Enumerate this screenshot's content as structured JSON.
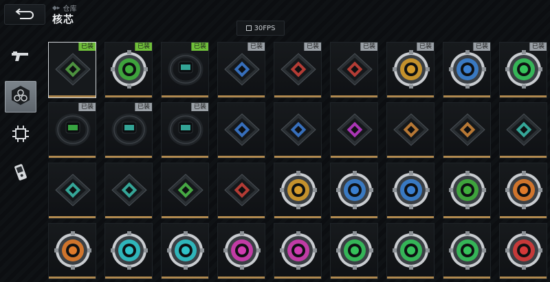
{
  "header": {
    "breadcrumb": "仓库",
    "title": "核芯",
    "fps_label": "30FPS"
  },
  "sidebar": {
    "items": [
      {
        "icon": "gun-icon",
        "active": false
      },
      {
        "icon": "core-hex-icon",
        "active": true
      },
      {
        "icon": "chip-icon",
        "active": false
      },
      {
        "icon": "device-icon",
        "active": false
      }
    ]
  },
  "colors": {
    "equipped_green": "#6fbf3a",
    "equipped_gray": "#9aa0a6",
    "rarity_bar": "#b0894f"
  },
  "grid": {
    "rows": [
      [
        {
          "kind": "chip",
          "color": "#57a845",
          "tag": "已装",
          "tag_style": "green",
          "selected": true
        },
        {
          "kind": "disc",
          "color": "#3fae3c",
          "tag": "已装",
          "tag_style": "green"
        },
        {
          "kind": "band",
          "color": "#3bbfae",
          "tag": "已装",
          "tag_style": "green"
        },
        {
          "kind": "chip",
          "color": "#3d7fd8",
          "tag": "已装",
          "tag_style": "gray"
        },
        {
          "kind": "chip",
          "color": "#d0433a",
          "tag": "已装",
          "tag_style": "gray"
        },
        {
          "kind": "chip",
          "color": "#d0433a",
          "tag": "已装",
          "tag_style": "gray"
        },
        {
          "kind": "disc",
          "color": "#d49a2a",
          "tag": "已装",
          "tag_style": "gray"
        },
        {
          "kind": "disc",
          "color": "#3a7fd0",
          "tag": "已装",
          "tag_style": "gray"
        },
        {
          "kind": "disc",
          "color": "#35c25a",
          "tag": "已装",
          "tag_style": "gray"
        }
      ],
      [
        {
          "kind": "band",
          "color": "#3fbf4a",
          "tag": "已装",
          "tag_style": "gray"
        },
        {
          "kind": "band",
          "color": "#3bbfae",
          "tag": "已装",
          "tag_style": "gray"
        },
        {
          "kind": "band",
          "color": "#3bbfae",
          "tag": "已装",
          "tag_style": "gray"
        },
        {
          "kind": "chip",
          "color": "#3d7fd8"
        },
        {
          "kind": "chip",
          "color": "#3d7fd8"
        },
        {
          "kind": "chip",
          "color": "#c43bd0"
        },
        {
          "kind": "chip",
          "color": "#d48a3a"
        },
        {
          "kind": "chip",
          "color": "#d48a3a"
        },
        {
          "kind": "chip",
          "color": "#3bbfae"
        }
      ],
      [
        {
          "kind": "chip",
          "color": "#3bbfae"
        },
        {
          "kind": "chip",
          "color": "#3bbfae"
        },
        {
          "kind": "chip",
          "color": "#4fc24a"
        },
        {
          "kind": "chip",
          "color": "#d0433a"
        },
        {
          "kind": "disc",
          "color": "#d49a2a"
        },
        {
          "kind": "disc",
          "color": "#3a7fd0"
        },
        {
          "kind": "disc",
          "color": "#3a7fd0"
        },
        {
          "kind": "disc",
          "color": "#3fae3c"
        },
        {
          "kind": "disc",
          "color": "#e07a2a"
        }
      ],
      [
        {
          "kind": "disc",
          "color": "#e07a2a"
        },
        {
          "kind": "disc",
          "color": "#2fc2c8"
        },
        {
          "kind": "disc",
          "color": "#2fc2c8"
        },
        {
          "kind": "disc",
          "color": "#d03bb0"
        },
        {
          "kind": "disc",
          "color": "#d03bb0"
        },
        {
          "kind": "disc",
          "color": "#35c25a"
        },
        {
          "kind": "disc",
          "color": "#35c25a"
        },
        {
          "kind": "disc",
          "color": "#35c25a"
        },
        {
          "kind": "disc",
          "color": "#d63838"
        }
      ]
    ]
  }
}
